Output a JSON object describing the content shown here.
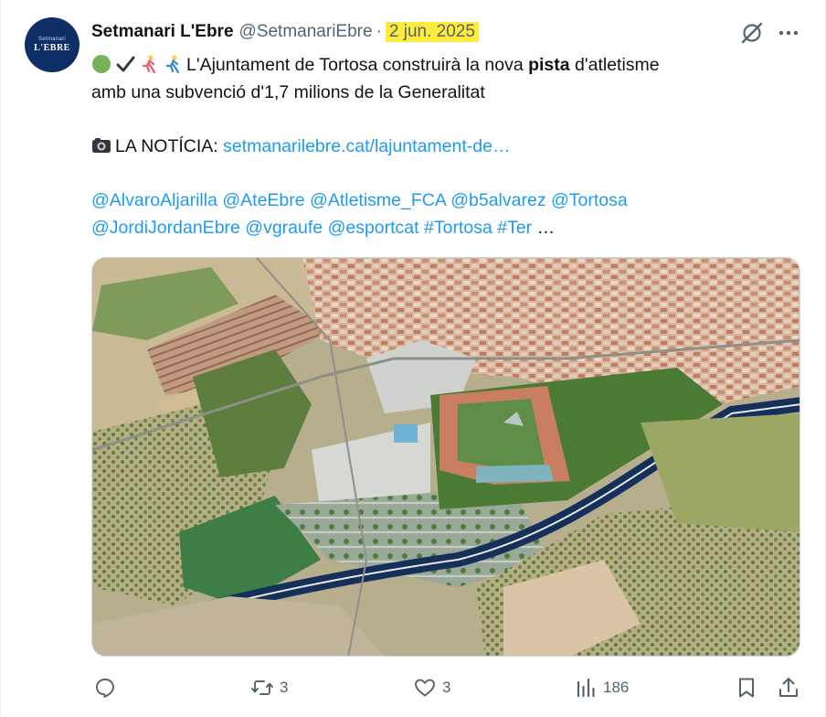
{
  "author": {
    "avatar_small_text": "Setmanari",
    "avatar_big_text": "L'EBRE",
    "display_name": "Setmanari L'Ebre",
    "handle": "@SetmanariEbre",
    "separator": "·",
    "date": "2 jun. 2025"
  },
  "tweet": {
    "line1_text": "L'Ajuntament de Tortosa construirà la nova ",
    "line1_bold": "pista",
    "line1_rest": " d'atletisme",
    "line2": "amb una subvenció d'1,7 milions de la Generalitat",
    "news_label": "LA NOTÍCIA: ",
    "news_link": "setmanarilebre.cat/lajuntament-de…",
    "mentions_line1": [
      "@AlvaroAljarilla",
      "@AteEbre",
      "@Atletisme_FCA",
      "@b5alvarez",
      "@Tortosa"
    ],
    "mentions_line2": [
      "@JordiJordanEbre",
      "@vgraufe",
      "@esportcat",
      "#Tortosa",
      "#Ter"
    ],
    "ellipsis": "…"
  },
  "actions": {
    "replies": "",
    "retweets": "3",
    "likes": "3",
    "views": "186"
  },
  "icons": [
    "green-circle-emoji-icon",
    "check-mark-emoji-icon",
    "runner-emoji-icon",
    "runner-emoji-icon",
    "camera-emoji-icon",
    "grok-icon",
    "more-icon",
    "reply-icon",
    "retweet-icon",
    "like-icon",
    "views-icon",
    "bookmark-icon",
    "share-icon"
  ],
  "colors": {
    "link": "#1d9bf0",
    "secondary": "#536471",
    "date_highlight": "#ffeb3b",
    "avatar_bg": "#0d2f66"
  }
}
